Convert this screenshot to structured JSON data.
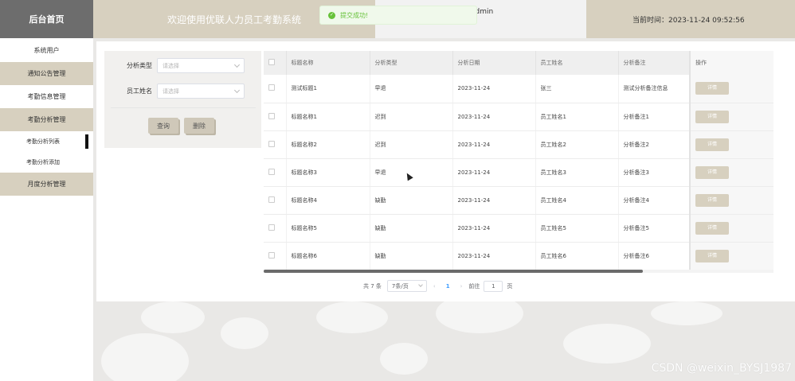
{
  "header": {
    "brand": "后台首页",
    "welcome": "欢迎使用优联人力员工考勤系统",
    "user": "admin",
    "time": "当前时间：2023-11-24 09:52:56"
  },
  "toast": {
    "message": "提交成功!"
  },
  "sidebar": {
    "items": [
      {
        "label": "系统用户"
      },
      {
        "label": "通知公告管理"
      },
      {
        "label": "考勤信息管理"
      },
      {
        "label": "考勤分析管理"
      },
      {
        "label": "考勤分析列表"
      },
      {
        "label": "考勤分析添加"
      },
      {
        "label": "月度分析管理"
      }
    ]
  },
  "search": {
    "type_label": "分析类型",
    "type_placeholder": "请选择",
    "name_label": "员工姓名",
    "name_placeholder": "请选择",
    "query_button": "查询",
    "delete_button": "删除"
  },
  "table": {
    "columns": [
      "标题名称",
      "分析类型",
      "分析日期",
      "员工姓名",
      "分析备注",
      "操作"
    ],
    "rows": [
      {
        "title": "测试标题1",
        "type": "早退",
        "date": "2023-11-24",
        "name": "张三",
        "remark": "测试分析备注信息",
        "action": "详情"
      },
      {
        "title": "标题名称1",
        "type": "迟到",
        "date": "2023-11-24",
        "name": "员工姓名1",
        "remark": "分析备注1",
        "action": "详情"
      },
      {
        "title": "标题名称2",
        "type": "迟到",
        "date": "2023-11-24",
        "name": "员工姓名2",
        "remark": "分析备注2",
        "action": "详情"
      },
      {
        "title": "标题名称3",
        "type": "早退",
        "date": "2023-11-24",
        "name": "员工姓名3",
        "remark": "分析备注3",
        "action": "详情"
      },
      {
        "title": "标题名称4",
        "type": "缺勤",
        "date": "2023-11-24",
        "name": "员工姓名4",
        "remark": "分析备注4",
        "action": "详情"
      },
      {
        "title": "标题名称5",
        "type": "缺勤",
        "date": "2023-11-24",
        "name": "员工姓名5",
        "remark": "分析备注5",
        "action": "详情"
      },
      {
        "title": "标题名称6",
        "type": "缺勤",
        "date": "2023-11-24",
        "name": "员工姓名6",
        "remark": "分析备注6",
        "action": "详情"
      }
    ]
  },
  "pagination": {
    "total": "共 7 条",
    "page_size": "7条/页",
    "prev": "‹",
    "current": "1",
    "next": "›",
    "goto_label": "前往",
    "goto_value": "1",
    "page_suffix": "页"
  },
  "watermark": "CSDN @weixin_BYSJ1987",
  "colors": {
    "accent": "#d7d0bf",
    "brand_bg": "#6d6d6d",
    "success": "#67c23a"
  }
}
